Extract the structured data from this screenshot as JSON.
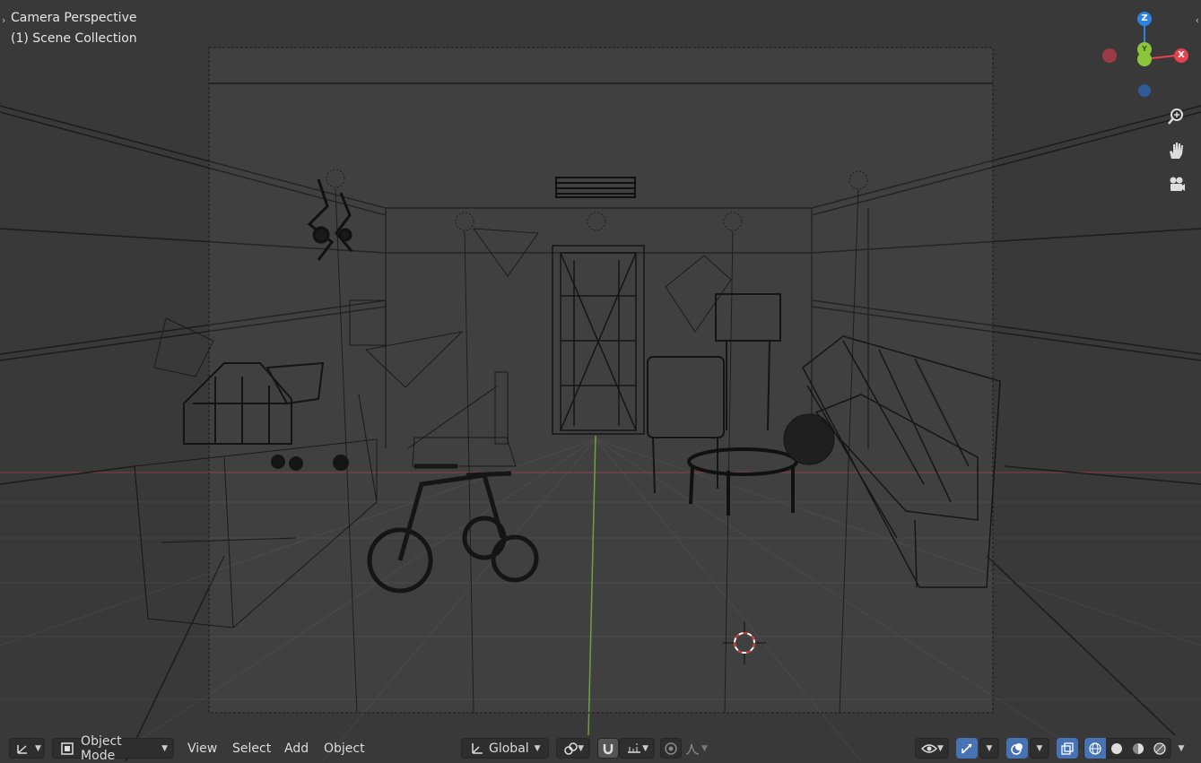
{
  "viewport": {
    "title": "Camera Perspective",
    "collection": "(1) Scene Collection"
  },
  "gizmo": {
    "z_label": "Z",
    "y_label": "Y",
    "x_label": "X",
    "colors": {
      "x": "#e5444e",
      "y": "#8ac53a",
      "z": "#2f83e0"
    },
    "tools": [
      "zoom-icon",
      "pan-hand-icon",
      "camera-view-icon"
    ]
  },
  "header": {
    "editor_type_icon": "viewport-editor-icon",
    "mode": "Object Mode",
    "menus": [
      "View",
      "Select",
      "Add",
      "Object"
    ],
    "transform_orientation": "Global",
    "pivot_icon": "pivot-point-icon",
    "snap_icon": "snap-magnet-icon",
    "snap_target_icon": "snap-increment-icon",
    "proportional_icon": "proportional-edit-icon",
    "falloff_icon": "falloff-curve-icon",
    "visibility_icon": "eye-visibility-icon",
    "gizmo_toggle_icon": "gizmo-toggle-icon",
    "overlay_icon": "overlay-icon",
    "xray_icon": "xray-toggle-icon",
    "shading_modes": [
      "wireframe-shading-icon",
      "solid-shading-icon",
      "material-shading-icon",
      "rendered-shading-icon"
    ]
  }
}
